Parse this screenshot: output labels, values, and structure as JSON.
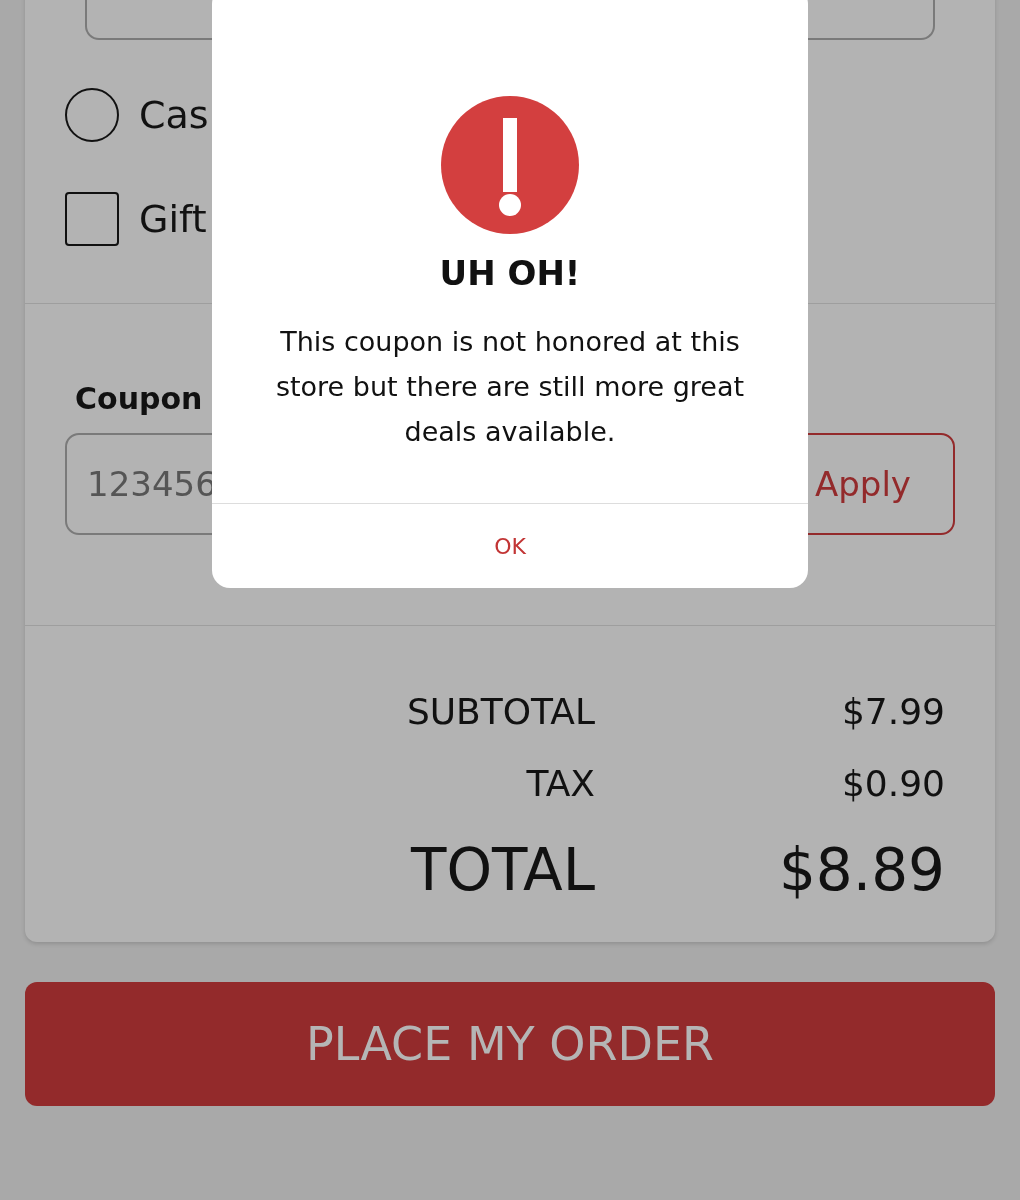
{
  "payment_options": [
    {
      "kind": "radio",
      "label": "Cas",
      "selected": false
    },
    {
      "kind": "checkbox",
      "label": "Gift",
      "checked": false
    }
  ],
  "coupon": {
    "label": "Coupon",
    "placeholder": "123456",
    "apply_button": "Apply"
  },
  "totals": [
    {
      "kind": "line",
      "label": "SUBTOTAL",
      "value": "$7.99"
    },
    {
      "kind": "line",
      "label": "TAX",
      "value": "$0.90"
    },
    {
      "kind": "grand",
      "label": "TOTAL",
      "value": "$8.89"
    }
  ],
  "place_order_button": "PLACE MY ORDER",
  "dialog": {
    "title": "UH OH!",
    "message": "This coupon is not honored at this store but there are still more great deals available.",
    "ok_button": "OK"
  }
}
